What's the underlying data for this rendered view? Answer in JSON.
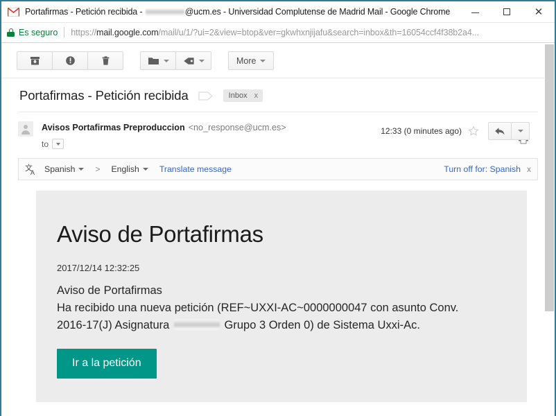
{
  "window": {
    "title_prefix": "Portafirmas - Petición recibida - ",
    "title_suffix": "@ucm.es - Universidad Complutense de Madrid Mail - Google Chrome",
    "app_icon": "gmail-icon",
    "minimize_label": "Minimize",
    "maximize_label": "Maximize",
    "close_label": "Close",
    "border_color": "#2f7d95"
  },
  "omnibox": {
    "lock_icon": "lock-icon",
    "secure_label": "Es seguro",
    "url_scheme": "https://",
    "url_host": "mail.google.com",
    "url_path": "/mail/u/1/?ui=2&view=btop&ver=gkwhxnjijafu&search=inbox&th=16054ccf4f38b2a4...",
    "secure_color": "#0b7d3e"
  },
  "toolbar": {
    "archive_label": "Archive",
    "archive_icon": "archive-icon",
    "spam_label": "Report spam",
    "spam_icon": "report-spam-icon",
    "delete_label": "Delete",
    "delete_icon": "trash-icon",
    "move_label": "Move to",
    "move_icon": "folder-icon",
    "labels_label": "Labels",
    "labels_icon": "tag-icon",
    "more_label": "More",
    "caret_icon": "chevron-down-icon"
  },
  "thread": {
    "subject": "Portafirmas - Petición recibida",
    "label_outline_icon": "label-outline-icon",
    "chip_label": "Inbox",
    "chip_remove": "x",
    "print_icon": "print-icon"
  },
  "message": {
    "avatar_icon": "avatar-icon",
    "sender_name": "Avisos Portafirmas Preproduccion",
    "sender_email": "<no_response@ucm.es>",
    "to_label": "to",
    "to_caret_icon": "chevron-down-icon",
    "timestamp": "12:33 (0 minutes ago)",
    "star_icon": "star-outline-icon",
    "reply_icon": "reply-icon",
    "more_actions_icon": "chevron-down-icon"
  },
  "translate": {
    "icon": "translate-icon",
    "source_lang": "Spanish",
    "arrow": ">",
    "target_lang": "English",
    "action_label": "Translate message",
    "turn_off_label": "Turn off for: Spanish",
    "close_icon": "x",
    "link_color": "#3366cc"
  },
  "email_body": {
    "heading": "Aviso de Portafirmas",
    "date": "2017/12/14 12:32:25",
    "line1": "Aviso de Portafirmas",
    "line2_part1": "Ha recibido una nueva petición (REF~UXXI-AC~0000000047 con asunto Conv. 2016-17(J) Asignatura ",
    "line2_part2": " Grupo 3 Orden 0) de Sistema Uxxi-Ac.",
    "cta_label": "Ir a la petición",
    "cta_color": "#009688",
    "panel_color": "#ececec"
  },
  "scrollbar": {
    "thumb_label": "vertical-scroll-thumb"
  }
}
